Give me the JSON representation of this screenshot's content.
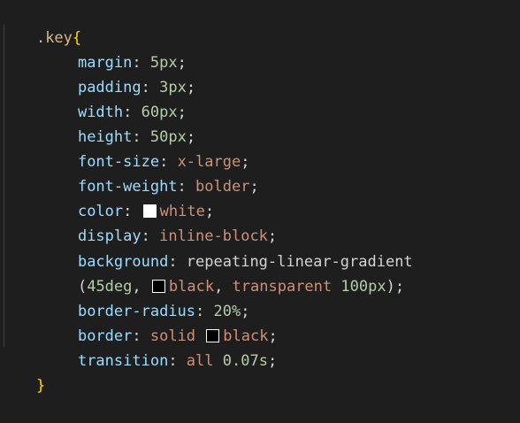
{
  "code": {
    "selector": ".key",
    "open_brace": "{",
    "close_brace": "}",
    "margin": {
      "prop": "margin",
      "colon": ": ",
      "value": "5px",
      "semi": ";"
    },
    "padding": {
      "prop": "padding",
      "colon": ": ",
      "value": "3px",
      "semi": ";"
    },
    "width": {
      "prop": "width",
      "colon": ": ",
      "value": "60px",
      "semi": ";"
    },
    "height": {
      "prop": "height",
      "colon": ": ",
      "value": "50px",
      "semi": ";"
    },
    "font_size": {
      "prop": "font-size",
      "colon": ": ",
      "value": "x-large",
      "semi": ";"
    },
    "font_weight": {
      "prop": "font-weight",
      "colon": ": ",
      "value": "bolder",
      "semi": ";"
    },
    "color": {
      "prop": "color",
      "colon": ": ",
      "value": "white",
      "semi": ";",
      "swatch_color": "#ffffff"
    },
    "display": {
      "prop": "display",
      "colon": ": ",
      "value": "inline-block",
      "semi": ";"
    },
    "background": {
      "prop": "background",
      "colon": ": ",
      "value": "repeating-linear-gradient",
      "open_paren": "(",
      "angle": "45deg",
      "comma1": ", ",
      "color1": "black",
      "color1_swatch": "#000000",
      "comma2": ", ",
      "color2": "transparent",
      "space": " ",
      "stop": "100px",
      "close_paren": ")",
      "semi": ";"
    },
    "border_radius": {
      "prop": "border-radius",
      "colon": ": ",
      "value": "20%",
      "semi": ";"
    },
    "border": {
      "prop": "border",
      "colon": ": ",
      "style": "solid",
      "space": " ",
      "value": "black",
      "semi": ";",
      "swatch_color": "#000000"
    },
    "transition": {
      "prop": "transition",
      "colon": ": ",
      "what": "all",
      "space": " ",
      "duration": "0.07s",
      "semi": ";"
    }
  },
  "colors": {
    "background": "#1e1e1e",
    "selector": "#d7ba7d",
    "brace": "#ffd700",
    "property": "#9cdcfe",
    "number": "#b5cea8",
    "string_value": "#ce9178",
    "punctuation": "#d4d4d4"
  }
}
